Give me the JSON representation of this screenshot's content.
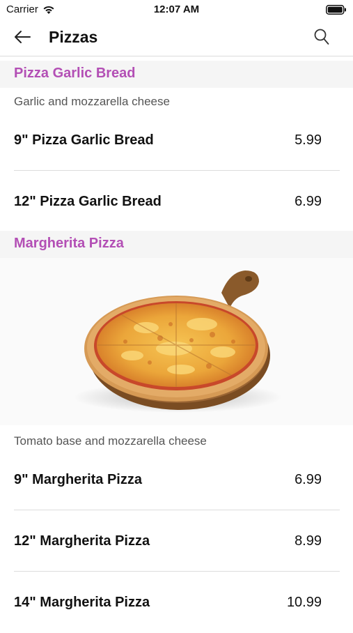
{
  "status_bar": {
    "carrier": "Carrier",
    "time": "12:07 AM"
  },
  "nav": {
    "title": "Pizzas",
    "back_icon": "arrow-left-icon",
    "search_icon": "search-icon"
  },
  "colors": {
    "section_title": "#b34fb5",
    "section_header_bg": "#f5f5f5"
  },
  "sections": [
    {
      "title": "Pizza Garlic Bread",
      "description": "Garlic and mozzarella cheese",
      "items": [
        {
          "name": "9\" Pizza Garlic Bread",
          "price": "5.99"
        },
        {
          "name": "12\" Pizza Garlic Bread",
          "price": "6.99"
        }
      ]
    },
    {
      "title": "Margherita Pizza",
      "image": "pizza-on-wooden-board",
      "description": "Tomato base and mozzarella cheese",
      "items": [
        {
          "name": "9\" Margherita Pizza",
          "price": "6.99"
        },
        {
          "name": "12\" Margherita Pizza",
          "price": "8.99"
        },
        {
          "name": "14\" Margherita Pizza",
          "price": "10.99"
        }
      ]
    }
  ]
}
